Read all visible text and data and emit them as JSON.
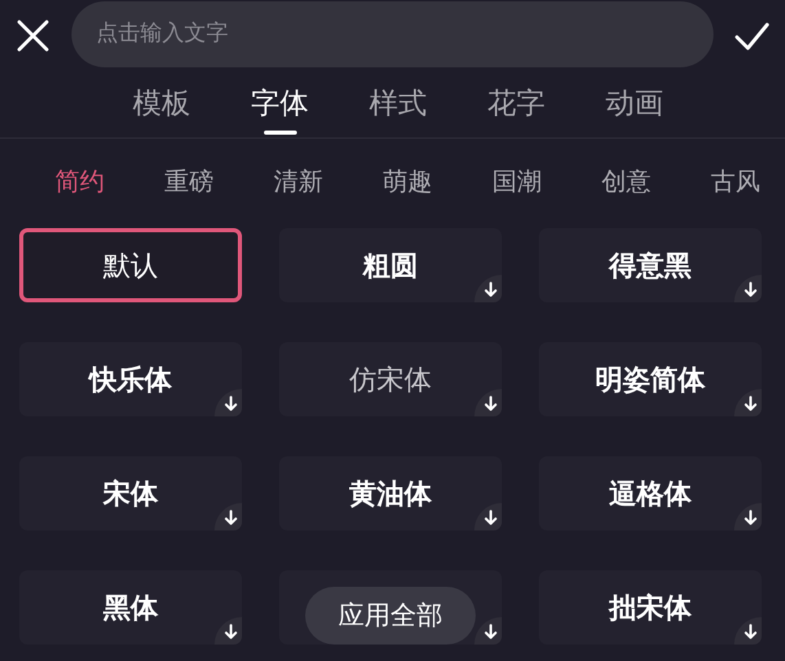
{
  "search": {
    "placeholder": "点击输入文字"
  },
  "tabs": [
    {
      "label": "模板",
      "selected": false
    },
    {
      "label": "字体",
      "selected": true
    },
    {
      "label": "样式",
      "selected": false
    },
    {
      "label": "花字",
      "selected": false
    },
    {
      "label": "动画",
      "selected": false
    }
  ],
  "categories": [
    {
      "label": "简约",
      "selected": true
    },
    {
      "label": "重磅",
      "selected": false
    },
    {
      "label": "清新",
      "selected": false
    },
    {
      "label": "萌趣",
      "selected": false
    },
    {
      "label": "国潮",
      "selected": false
    },
    {
      "label": "创意",
      "selected": false
    },
    {
      "label": "古风",
      "selected": false
    }
  ],
  "fonts": [
    {
      "name": "默认",
      "kind": "regular",
      "selected": true,
      "downloadable": false
    },
    {
      "name": "粗圆",
      "kind": "bold",
      "selected": false,
      "downloadable": true
    },
    {
      "name": "得意黑",
      "kind": "bold",
      "selected": false,
      "downloadable": true
    },
    {
      "name": "快乐体",
      "kind": "bold",
      "selected": false,
      "downloadable": true
    },
    {
      "name": "仿宋体",
      "kind": "light",
      "selected": false,
      "downloadable": true
    },
    {
      "name": "明姿简体",
      "kind": "bold",
      "selected": false,
      "downloadable": true
    },
    {
      "name": "宋体",
      "kind": "bold",
      "selected": false,
      "downloadable": true
    },
    {
      "name": "黄油体",
      "kind": "bold",
      "selected": false,
      "downloadable": true
    },
    {
      "name": "逼格体",
      "kind": "bold",
      "selected": false,
      "downloadable": true
    },
    {
      "name": "黑体",
      "kind": "bold",
      "selected": false,
      "downloadable": true
    },
    {
      "kind": "bold",
      "selected": false,
      "downloadable": true,
      "overlay_button": "应用全部"
    },
    {
      "name": "拙宋体",
      "kind": "bold",
      "selected": false,
      "downloadable": true
    }
  ]
}
